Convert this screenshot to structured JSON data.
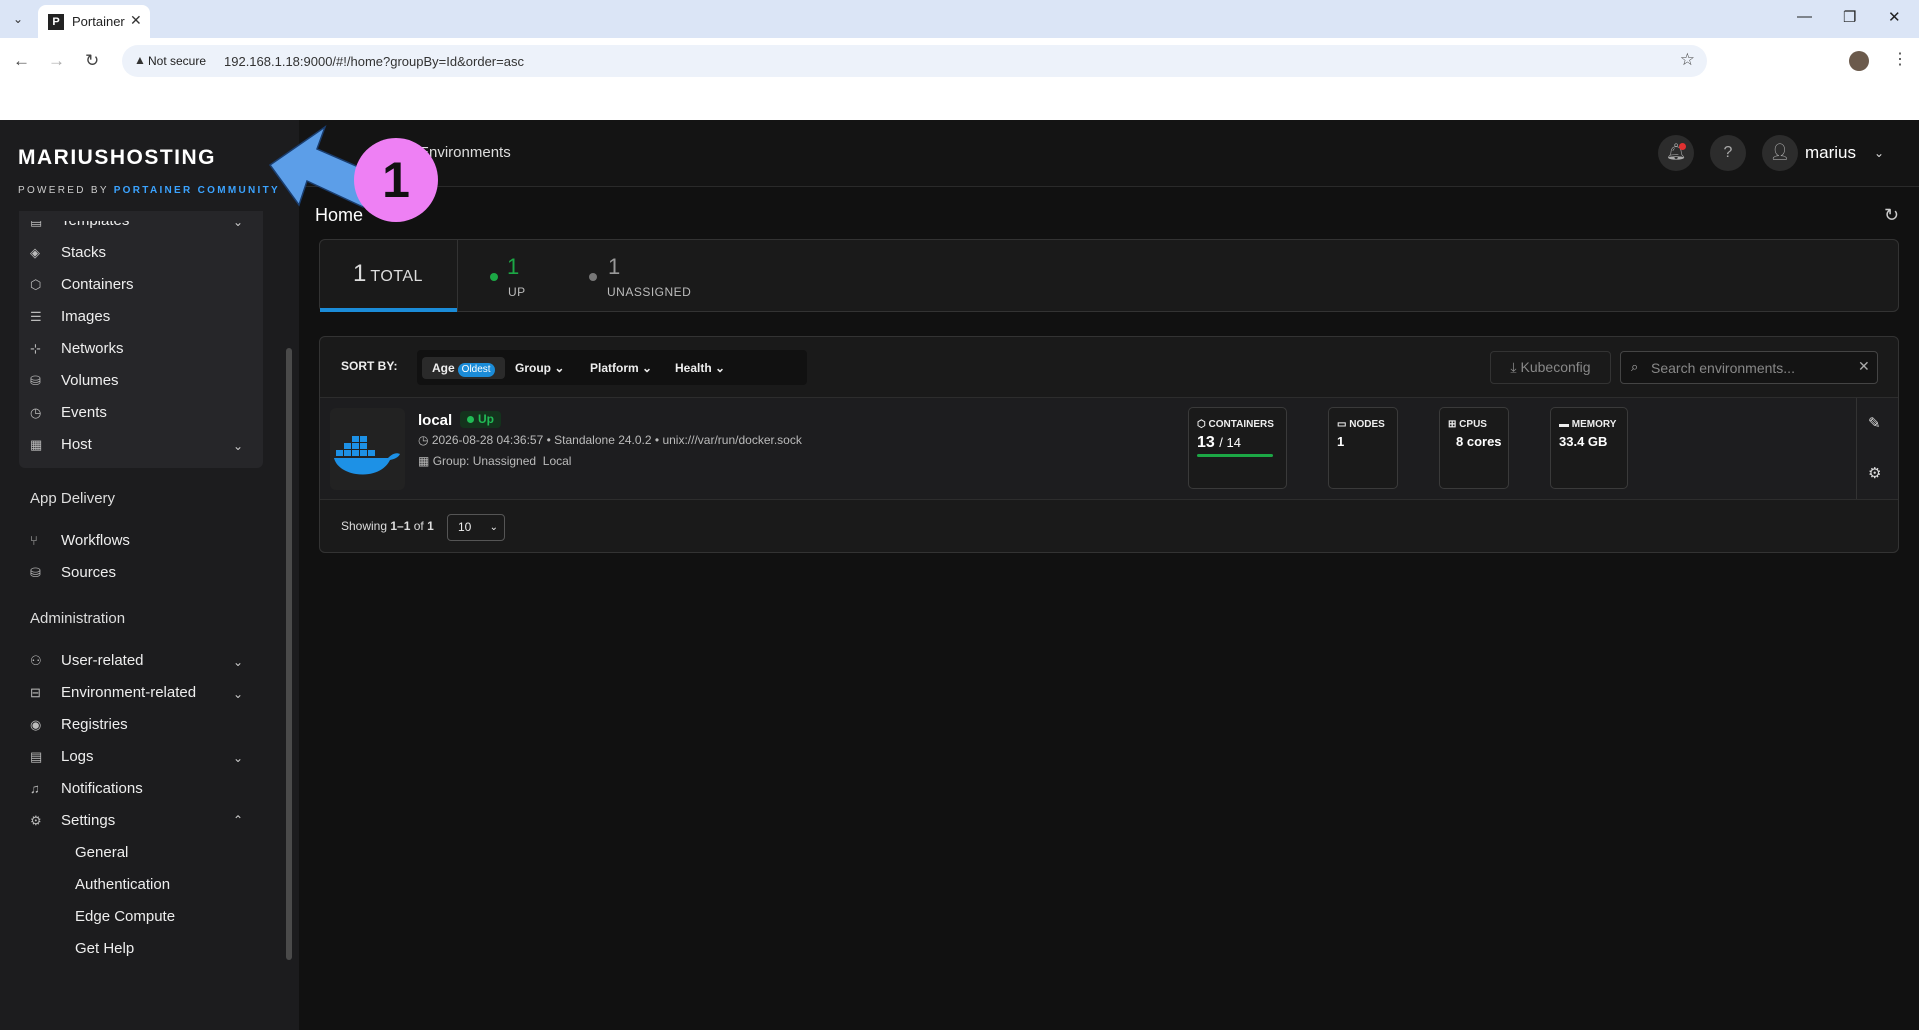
{
  "browser": {
    "tab_title": "Portainer",
    "tab_favicon": "P",
    "not_secure": "Not secure",
    "url": "192.168.1.18:9000/#!/home?groupBy=Id&order=asc"
  },
  "sidebar": {
    "logo": "MARIUSHOSTING",
    "powered_by_prefix": "POWERED BY",
    "powered_by_brand": "PORTAINER COMMUNITY",
    "group_items": [
      {
        "label": "Templates",
        "icon": "file-icon"
      },
      {
        "label": "Stacks",
        "icon": "layers-icon"
      },
      {
        "label": "Containers",
        "icon": "box-icon"
      },
      {
        "label": "Images",
        "icon": "list-icon"
      },
      {
        "label": "Networks",
        "icon": "network-icon"
      },
      {
        "label": "Volumes",
        "icon": "database-icon"
      },
      {
        "label": "Events",
        "icon": "clock-icon"
      },
      {
        "label": "Host",
        "icon": "server-icon"
      }
    ],
    "app_delivery": {
      "heading": "App Delivery",
      "items": [
        {
          "label": "Workflows",
          "icon": "git-branch-icon"
        },
        {
          "label": "Sources",
          "icon": "database-icon"
        }
      ]
    },
    "administration": {
      "heading": "Administration",
      "items": [
        {
          "label": "User-related",
          "icon": "users-icon"
        },
        {
          "label": "Environment-related",
          "icon": "hdd-icon"
        },
        {
          "label": "Registries",
          "icon": "radio-icon"
        },
        {
          "label": "Logs",
          "icon": "file-icon"
        },
        {
          "label": "Notifications",
          "icon": "bell-icon"
        },
        {
          "label": "Settings",
          "icon": "gear-icon"
        }
      ],
      "settings_sub": [
        "General",
        "Authentication",
        "Edge Compute",
        "Get Help"
      ]
    }
  },
  "topbar": {
    "breadcrumb": "Environments",
    "username": "marius"
  },
  "page": {
    "title": "Home"
  },
  "stats": {
    "total_count": "1",
    "total_label": "TOTAL",
    "up_count": "1",
    "up_label": "UP",
    "unassigned_count": "1",
    "unassigned_label": "UNASSIGNED"
  },
  "toolbar": {
    "sort_by": "SORT BY:",
    "sort_age": "Age",
    "sort_age_badge": "Oldest",
    "sort_group": "Group",
    "sort_platform": "Platform",
    "sort_health": "Health",
    "kubeconfig": "Kubeconfig",
    "search_placeholder": "Search environments..."
  },
  "environment": {
    "name": "local",
    "status": "Up",
    "timestamp": "2026-08-28 04:36:57",
    "version": "Standalone 24.0.2",
    "socket": "unix:///var/run/docker.sock",
    "group": "Group: Unassigned",
    "tag": "Local",
    "containers_title": "CONTAINERS",
    "containers_running": "13",
    "containers_total": "/ 14",
    "containers_running_fraction": 0.93,
    "nodes_title": "NODES",
    "nodes_value": "1",
    "cpus_title": "CPUS",
    "cpus_value": "8 cores",
    "memory_title": "MEMORY",
    "memory_value": "33.4 GB"
  },
  "pagination": {
    "showing_prefix": "Showing",
    "showing_range": "1–1",
    "showing_of": "of",
    "showing_total": "1",
    "page_size": "10"
  },
  "annotation": {
    "number": "1"
  },
  "colors": {
    "accent": "#1b8cd8",
    "status_up": "#1ca745",
    "annotation": "#ee80f4",
    "annotation_arrow": "#5c9ee8"
  }
}
